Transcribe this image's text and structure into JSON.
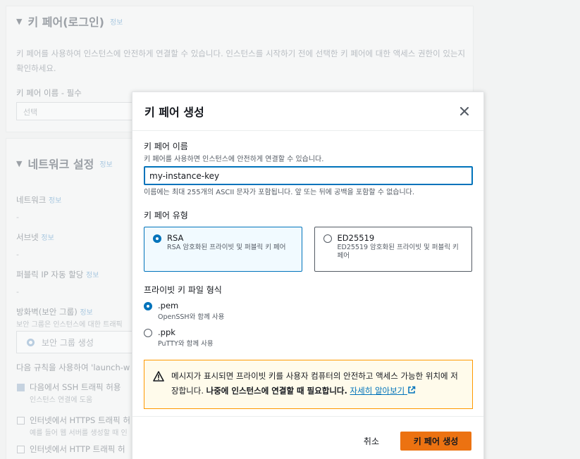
{
  "background": {
    "keypair_section": {
      "title": "키 페어(로그인)",
      "info": "정보",
      "description": "키 페어를 사용하여 인스턴스에 안전하게 연결할 수 있습니다. 인스턴스를 시작하기 전에 선택한 키 페어에 대한 액세스 권한이 있는지 확인하세요.",
      "field_label": "키 페어 이름 - 필수",
      "select_placeholder": "선택"
    },
    "network_section": {
      "title": "네트워크 설정",
      "info": "정보",
      "network_label": "네트워크",
      "subnet_label": "서브넷",
      "public_ip_label": "퍼블릭 IP 자동 할당",
      "firewall_label": "방화벽(보안 그룹)",
      "firewall_desc": "보안 그룹은 인스턴스에 대한 트래픽",
      "create_sg_label": "보안 그룹 생성",
      "rules_text": "다음 규칙을 사용하여 'launch-w",
      "ssh_label": "다음에서 SSH 트래픽 허용",
      "ssh_desc": "인스턴스 연결에 도움",
      "https_label": "인터넷에서 HTTPS 트래픽 허",
      "https_desc": "예를 들어 웹 서버를 생성할 때 인",
      "http_label": "인터넷에서 HTTP 트래픽 허",
      "info_small": "정보",
      "dash": "-"
    }
  },
  "modal": {
    "title": "키 페어 생성",
    "name_field": {
      "label": "키 페어 이름",
      "description": "키 페어를 사용하면 인스턴스에 안전하게 연결할 수 있습니다.",
      "value": "my-instance-key",
      "constraint": "이름에는 최대 255개의 ASCII 문자가 포함됩니다. 앞 또는 뒤에 공백을 포함할 수 없습니다."
    },
    "type_field": {
      "label": "키 페어 유형",
      "options": [
        {
          "title": "RSA",
          "description": "RSA 암호화된 프라이빗 및 퍼블릭 키 페어",
          "selected": true
        },
        {
          "title": "ED25519",
          "description": "ED25519 암호화된 프라이빗 및 퍼블릭 키 페어",
          "selected": false
        }
      ]
    },
    "format_field": {
      "label": "프라이빗 키 파일 형식",
      "options": [
        {
          "title": ".pem",
          "description": "OpenSSH와 함께 사용",
          "selected": true
        },
        {
          "title": ".ppk",
          "description": "PuTTY와 함께 사용",
          "selected": false
        }
      ]
    },
    "alert": {
      "text_normal": "메시지가 표시되면 프라이빗 키를 사용자 컴퓨터의 안전하고 액세스 가능한 위치에 저장합니다. ",
      "text_bold": "나중에 인스턴스에 연결할 때 필요합니다.",
      "link_text": "자세히 알아보기"
    },
    "footer": {
      "cancel_label": "취소",
      "create_label": "키 페어 생성"
    }
  },
  "colors": {
    "accent": "#0073bb",
    "primary_button": "#ec7211",
    "warning_border": "#ff9900",
    "warning_bg": "#fffbeb"
  },
  "icons": {
    "close": "close-icon",
    "warning": "warning-icon",
    "external_link": "external-link-icon"
  }
}
